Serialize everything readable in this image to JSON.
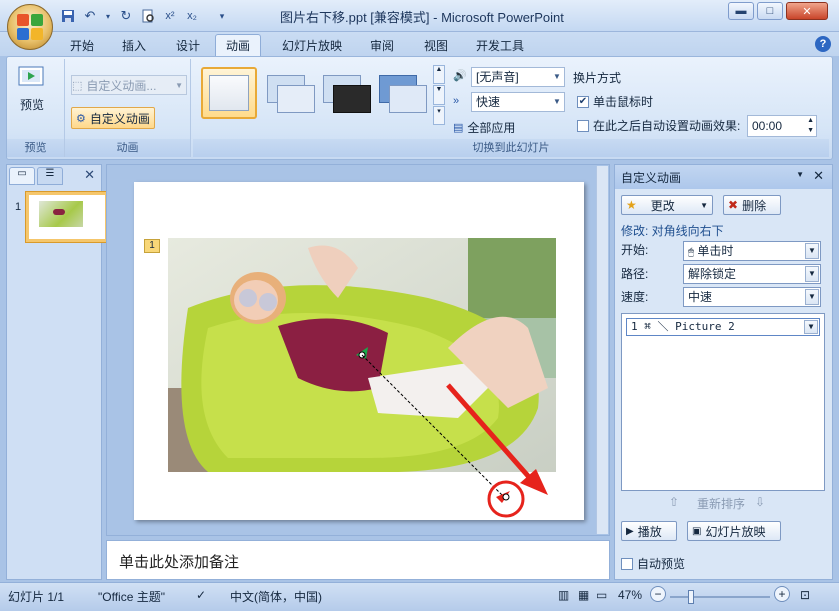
{
  "window": {
    "title": "图片右下移.ppt [兼容模式] - Microsoft PowerPoint",
    "minimize_icon": "minimize-icon",
    "maximize_icon": "maximize-icon",
    "close_icon": "close-icon"
  },
  "tabs": [
    "开始",
    "插入",
    "设计",
    "动画",
    "幻灯片放映",
    "审阅",
    "视图",
    "开发工具"
  ],
  "active_tab": "动画",
  "ribbon": {
    "preview_group": {
      "button_label": "预览",
      "group_label": "预览"
    },
    "animation_group": {
      "dropdown_value": "自定义动画...",
      "custom_button": "自定义动画",
      "group_label": "动画"
    },
    "transition_group": {
      "sound_value": "[无声音]",
      "speed_value": "快速",
      "apply_all": "全部应用",
      "group_label": "切换到此幻灯片"
    },
    "switch_group": {
      "title": "换片方式",
      "on_click": "单击鼠标时",
      "auto_after": "在此之后自动设置动画效果:",
      "time_value": "00:00"
    }
  },
  "left_panel": {
    "slide_number": "1"
  },
  "slide": {
    "anim_tag": "1"
  },
  "notes": {
    "placeholder": "单击此处添加备注"
  },
  "task_pane": {
    "title": "自定义动画",
    "change_button": "更改",
    "delete_button": "删除",
    "modify_label": "修改: 对角线向右下",
    "start_label": "开始:",
    "start_value": "单击时",
    "path_label": "路径:",
    "path_value": "解除锁定",
    "speed_label": "速度:",
    "speed_value": "中速",
    "list_item": "1 ⌘ ＼ Picture 2",
    "reorder_label": "重新排序",
    "play_button": "播放",
    "slideshow_button": "幻灯片放映",
    "autopreview_label": "自动预览"
  },
  "status": {
    "slide_info": "幻灯片 1/1",
    "theme": "\"Office 主题\"",
    "language": "中文(简体，中国)",
    "zoom": "47%"
  },
  "colors": {
    "accent": "#2d67c2",
    "arrow": "#e6231c",
    "path_start": "#1aa84b"
  }
}
